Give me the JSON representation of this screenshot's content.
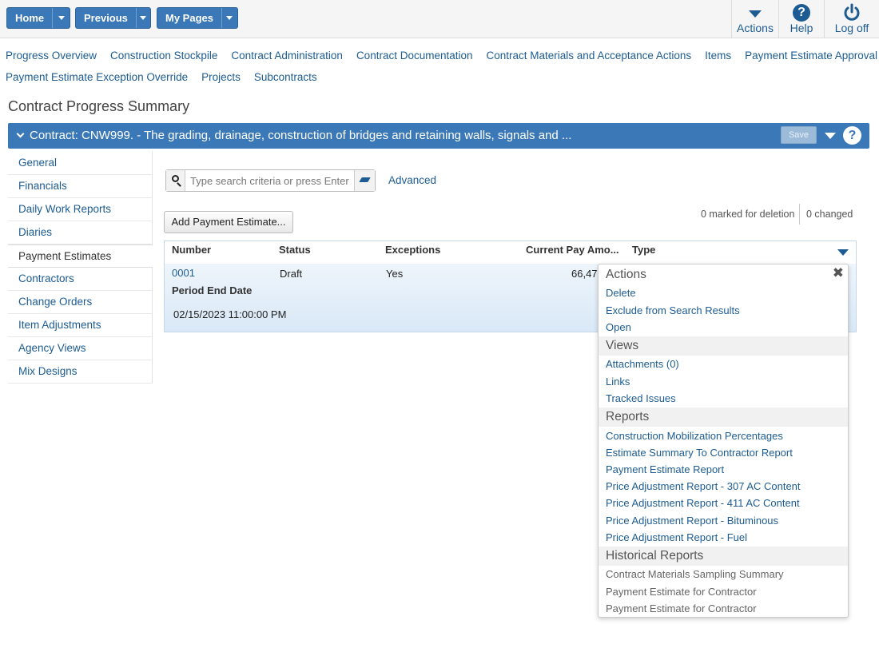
{
  "topnav": {
    "home": "Home",
    "previous": "Previous",
    "my_pages": "My Pages",
    "actions": "Actions",
    "help": "Help",
    "logoff": "Log off"
  },
  "links": {
    "row1": [
      "Progress Overview",
      "Construction Stockpile",
      "Contract Administration",
      "Contract Documentation",
      "Contract Materials and Acceptance Actions",
      "Items",
      "Payment Estimate Approval Levels"
    ],
    "row2": [
      "Payment Estimate Exception Override",
      "Projects",
      "Subcontracts"
    ]
  },
  "page_title": "Contract Progress Summary",
  "contract_bar": {
    "title": "Contract: CNW999. - The grading, drainage, construction of bridges and retaining walls, signals and ...",
    "save": "Save"
  },
  "sidenav": [
    "General",
    "Financials",
    "Daily Work Reports",
    "Diaries",
    "Payment Estimates",
    "Contractors",
    "Change Orders",
    "Item Adjustments",
    "Agency Views",
    "Mix Designs"
  ],
  "sidenav_active": "Payment Estimates",
  "search": {
    "placeholder": "Type search criteria or press Enter",
    "value": "",
    "advanced": "Advanced"
  },
  "add_button": "Add Payment Estimate...",
  "status": {
    "marked": "0 marked for deletion",
    "changed": "0 changed"
  },
  "grid": {
    "columns": [
      "Number",
      "Status",
      "Exceptions",
      "Current Pay Amo...",
      "Type"
    ],
    "row": {
      "number": "0001",
      "status": "Draft",
      "exceptions": "Yes",
      "amount": "66,47",
      "period_label": "Period End Date",
      "period_value": "02/15/2023 11:00:00 PM"
    }
  },
  "menu": {
    "actions_title": "Actions",
    "actions": [
      "Delete",
      "Exclude from Search Results",
      "Open"
    ],
    "views_title": "Views",
    "views": [
      "Attachments (0)",
      "Links",
      "Tracked Issues"
    ],
    "reports_title": "Reports",
    "reports": [
      "Construction Mobilization Percentages",
      "Estimate Summary To Contractor Report",
      "Payment Estimate Report",
      "Price Adjustment Report - 307 AC Content",
      "Price Adjustment Report - 411 AC Content",
      "Price Adjustment Report - Bituminous",
      "Price Adjustment Report - Fuel"
    ],
    "historical_title": "Historical Reports",
    "historical": [
      "Contract Materials Sampling Summary",
      "Payment Estimate for Contractor",
      "Payment Estimate for Contractor"
    ]
  }
}
